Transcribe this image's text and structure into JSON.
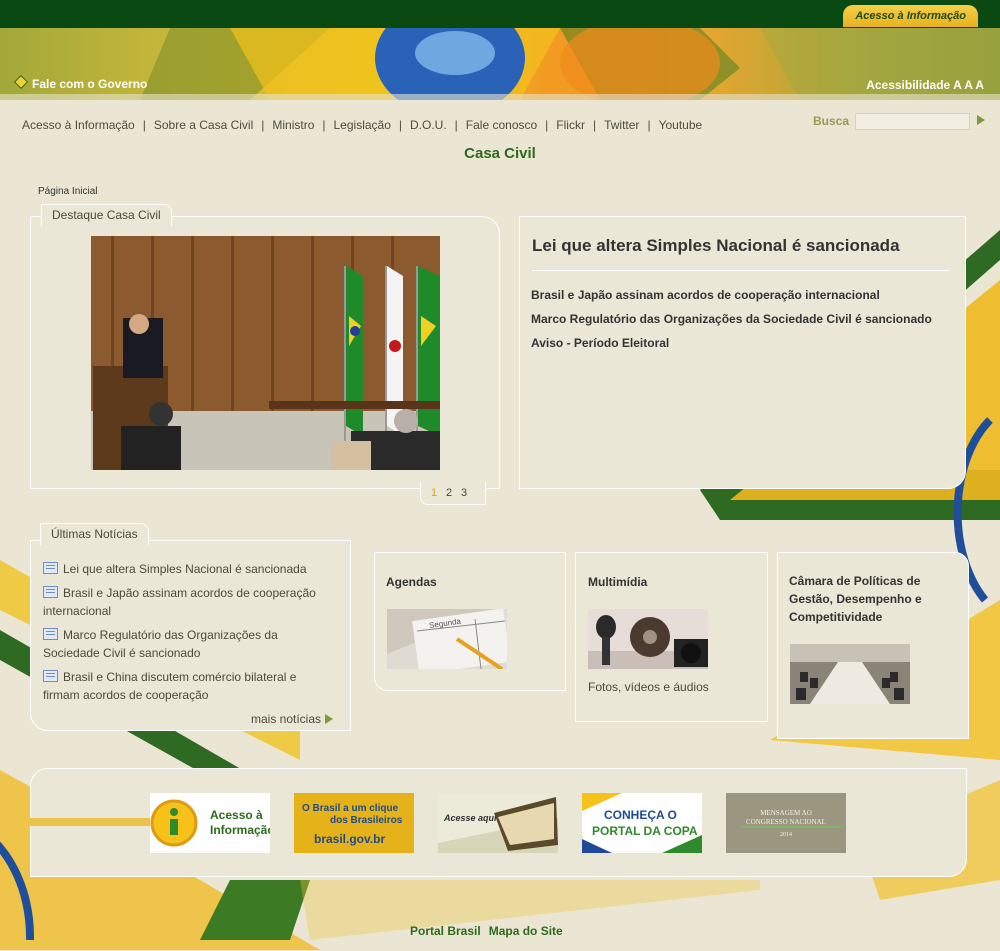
{
  "colors": {
    "top_bar": "#0a4a12",
    "accent_green": "#2e6a1a",
    "accent_yellow": "#f0c420",
    "background": "#ebe6d4"
  },
  "top_bar": {
    "acesso_label": "Acesso à Informação"
  },
  "banner": {
    "fale_label": "Fale com o Governo",
    "acessibilidade_label": "Acessibilidade A A A"
  },
  "nav": {
    "items": [
      "Acesso à Informação",
      "Sobre a Casa Civil",
      "Ministro",
      "Legislação",
      "D.O.U.",
      "Fale conosco",
      "Flickr",
      "Twitter",
      "Youtube"
    ]
  },
  "search": {
    "label": "Busca",
    "placeholder": ""
  },
  "site_title": "Casa Civil",
  "breadcrumb": "Página Inicial",
  "destaque": {
    "tab_label": "Destaque Casa Civil",
    "pages": [
      "1",
      "2",
      "3"
    ],
    "active_page": "1"
  },
  "headline": {
    "title": "Lei que altera Simples Nacional é sancionada",
    "links": [
      "Brasil e Japão assinam acordos de cooperação internacional",
      "Marco Regulatório das Organizações da Sociedade Civil é sancionado",
      "Aviso - Período Eleitoral"
    ]
  },
  "noticias": {
    "tab_label": "Últimas Notícias",
    "items": [
      "Lei que altera Simples Nacional é sancionada",
      "Brasil e Japão assinam acordos de cooperação internacional",
      "Marco Regulatório das Organizações da Sociedade Civil é sancionado",
      "Brasil e China discutem comércio bilateral e firmam acordos de cooperação"
    ],
    "more_label": "mais notícias"
  },
  "boxes": {
    "agendas": {
      "title": "Agendas",
      "image_text": "Segunda"
    },
    "multimidia": {
      "title": "Multimídia",
      "caption": "Fotos, vídeos e áudios"
    },
    "camara": {
      "title": "Câmara de Políticas de Gestão, Desempenho e Competitividade"
    }
  },
  "footer_banners": {
    "acesso": [
      "Acesso à",
      "Informação"
    ],
    "brasil": {
      "line1": "O Brasil a um clique",
      "line2": "dos Brasileiros",
      "url_text": "brasil.gov.br"
    },
    "acesse": {
      "label": "Acesse aqui"
    },
    "copa": {
      "line1": "CONHEÇA O",
      "line2": "PORTAL DA COPA"
    },
    "mensagem": {
      "line1": "MENSAGEM AO",
      "line2": "CONGRESSO NACIONAL",
      "year": "2014"
    }
  },
  "footer_links": [
    "Portal Brasil",
    "Mapa do Site"
  ]
}
